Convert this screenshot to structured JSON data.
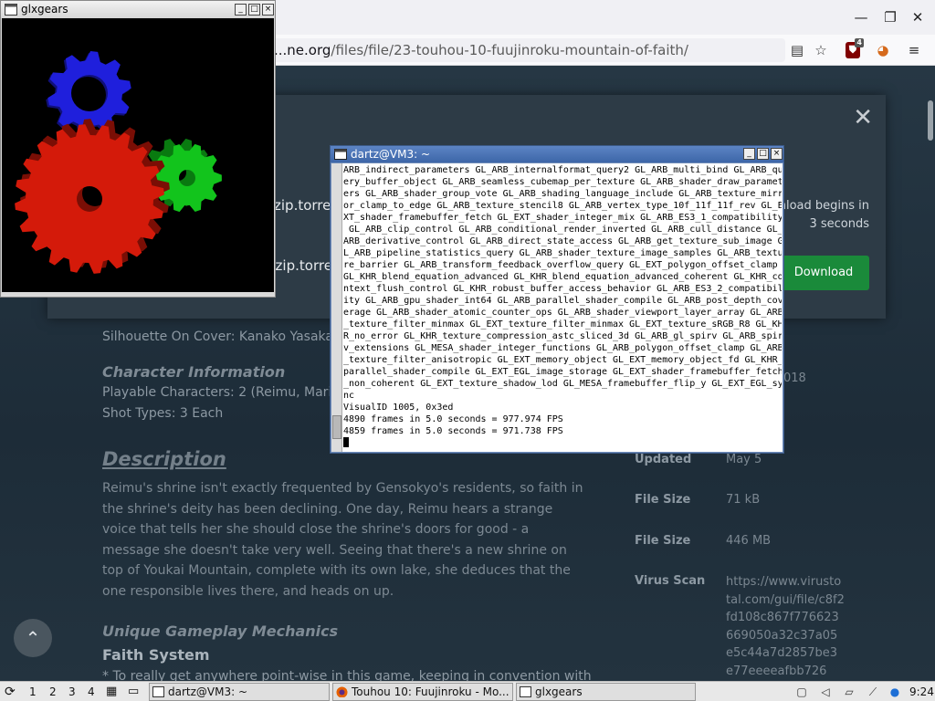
{
  "browser": {
    "url_host": "...ne.org",
    "url_path": "/files/file/23-touhou-10-fuujinroku-mountain-of-faith/",
    "ublock_count": "4",
    "window_controls": [
      "minimize-icon",
      "maximize-icon",
      "close-icon"
    ]
  },
  "modal": {
    "close": "✕",
    "filename_1": "zip.torre",
    "filename_2": "r.zip.torre",
    "download_msg_1": "nload begins in",
    "download_msg_2": "3 seconds",
    "download_button": "Download"
  },
  "page": {
    "silhouette": "Silhouette On Cover: Kanako Yasaka (",
    "char_info_heading": "Character Information",
    "playable": "Playable Characters: 2 (Reimu, Marisa",
    "shot_types": "Shot Types: 3 Each",
    "description_heading": "Description",
    "description": "Reimu's shrine isn't exactly frequented by Gensokyo's residents, so faith in the shrine's deity has been declining. One day, Reimu hears a strange voice that tells her she should close the shrine's doors for good - a message she doesn't take very well. Seeing that there's a new shrine on top of Youkai Mountain, complete with its own lake, she deduces that the one responsible lives there, and heads on up.",
    "unique_heading": "Unique Gameplay Mechanics",
    "faith_heading": "Faith System",
    "faith_text": "* To really get anywhere point-wise in this game, keeping in convention with",
    "side_date": "018",
    "side": [
      {
        "label": "Updated",
        "value": "May 5"
      },
      {
        "label": "File Size",
        "value": "71 kB"
      },
      {
        "label": "File Size",
        "value": "446 MB"
      },
      {
        "label": "Virus Scan",
        "value": "https://www.virustotal.com/gui/file/c8f2fd108c867f776623669050a32c37a05e5c44a7d2857be3e77eeeeafbb726"
      }
    ],
    "back_to_top": "⌃"
  },
  "glxgears": {
    "title": "glxgears",
    "gear_colors": {
      "red": "#d41a0a",
      "green": "#12c41c",
      "blue": "#1f1fdc"
    }
  },
  "terminal": {
    "title": "dartz@VM3: ~",
    "lines": [
      "ARB_indirect_parameters GL_ARB_internalformat_query2 GL_ARB_multi_bind GL_ARB_qu",
      "ery_buffer_object GL_ARB_seamless_cubemap_per_texture GL_ARB_shader_draw_paramet",
      "ers GL_ARB_shader_group_vote GL_ARB_shading_language_include GL_ARB_texture_mirr",
      "or_clamp_to_edge GL_ARB_texture_stencil8 GL_ARB_vertex_type_10f_11f_11f_rev GL_E",
      "XT_shader_framebuffer_fetch GL_EXT_shader_integer_mix GL_ARB_ES3_1_compatibility",
      " GL_ARB_clip_control GL_ARB_conditional_render_inverted GL_ARB_cull_distance GL_",
      "ARB_derivative_control GL_ARB_direct_state_access GL_ARB_get_texture_sub_image G",
      "L_ARB_pipeline_statistics_query GL_ARB_shader_texture_image_samples GL_ARB_textu",
      "re_barrier GL_ARB_transform_feedback_overflow_query GL_EXT_polygon_offset_clamp",
      "GL_KHR_blend_equation_advanced GL_KHR_blend_equation_advanced_coherent GL_KHR_co",
      "ntext_flush_control GL_KHR_robust_buffer_access_behavior GL_ARB_ES3_2_compatibil",
      "ity GL_ARB_gpu_shader_int64 GL_ARB_parallel_shader_compile GL_ARB_post_depth_cov",
      "erage GL_ARB_shader_atomic_counter_ops GL_ARB_shader_viewport_layer_array GL_ARB",
      "_texture_filter_minmax GL_EXT_texture_filter_minmax GL_EXT_texture_sRGB_R8 GL_KH",
      "R_no_error GL_KHR_texture_compression_astc_sliced_3d GL_ARB_gl_spirv GL_ARB_spir",
      "v_extensions GL_MESA_shader_integer_functions GL_ARB_polygon_offset_clamp GL_ARB",
      "_texture_filter_anisotropic GL_EXT_memory_object GL_EXT_memory_object_fd GL_KHR_",
      "parallel_shader_compile GL_EXT_EGL_image_storage GL_EXT_shader_framebuffer_fetch",
      "_non_coherent GL_EXT_texture_shadow_lod GL_MESA_framebuffer_flip_y GL_EXT_EGL_sy",
      "nc",
      "VisualID 1005, 0x3ed",
      "4890 frames in 5.0 seconds = 977.974 FPS",
      "4859 frames in 5.0 seconds = 971.738 FPS"
    ]
  },
  "taskbar": {
    "workspaces": [
      "1",
      "2",
      "3",
      "4"
    ],
    "tasks": [
      "dartz@VM3: ~",
      "Touhou 10: Fuujinroku - Mo...",
      "glxgears"
    ],
    "clock": "9:24"
  }
}
